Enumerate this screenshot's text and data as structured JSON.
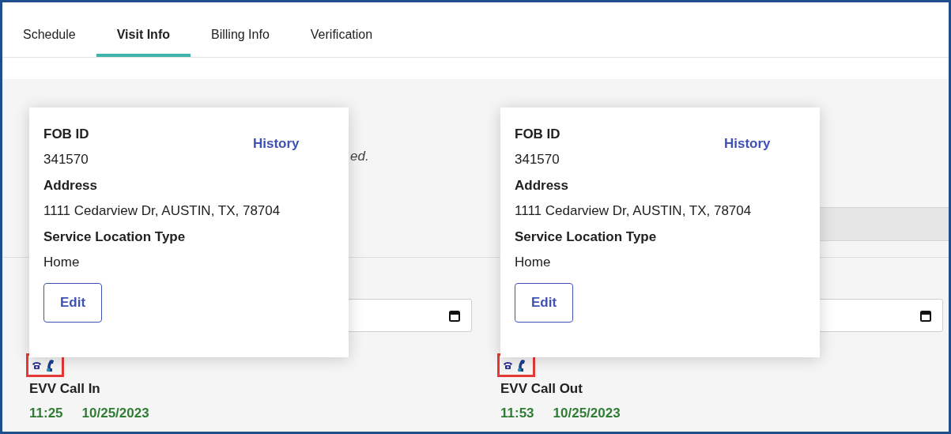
{
  "tabs": [
    {
      "label": "Schedule",
      "selected": false
    },
    {
      "label": "Visit Info",
      "selected": true
    },
    {
      "label": "Billing Info",
      "selected": false
    },
    {
      "label": "Verification",
      "selected": false
    }
  ],
  "panels": [
    {
      "note": "ed.",
      "gray_bar": false,
      "popover": {
        "fields": [
          {
            "label": "FOB ID",
            "value": "341570"
          },
          {
            "label": "Address",
            "value": "1111 Cedarview Dr, AUSTIN, TX, 78704"
          },
          {
            "label": "Service Location Type",
            "value": "Home"
          }
        ],
        "link": "History",
        "button": "Edit"
      },
      "call": {
        "label": "EVV Call In",
        "time": "11:25",
        "date": "10/25/2023"
      }
    },
    {
      "gray_bar": true,
      "popover": {
        "fields": [
          {
            "label": "FOB ID",
            "value": "341570"
          },
          {
            "label": "Address",
            "value": "1111 Cedarview Dr, AUSTIN, TX, 78704"
          },
          {
            "label": "Service Location Type",
            "value": "Home"
          }
        ],
        "link": "History",
        "button": "Edit"
      },
      "call": {
        "label": "EVV Call Out",
        "time": "11:53",
        "date": "10/25/2023"
      }
    }
  ]
}
